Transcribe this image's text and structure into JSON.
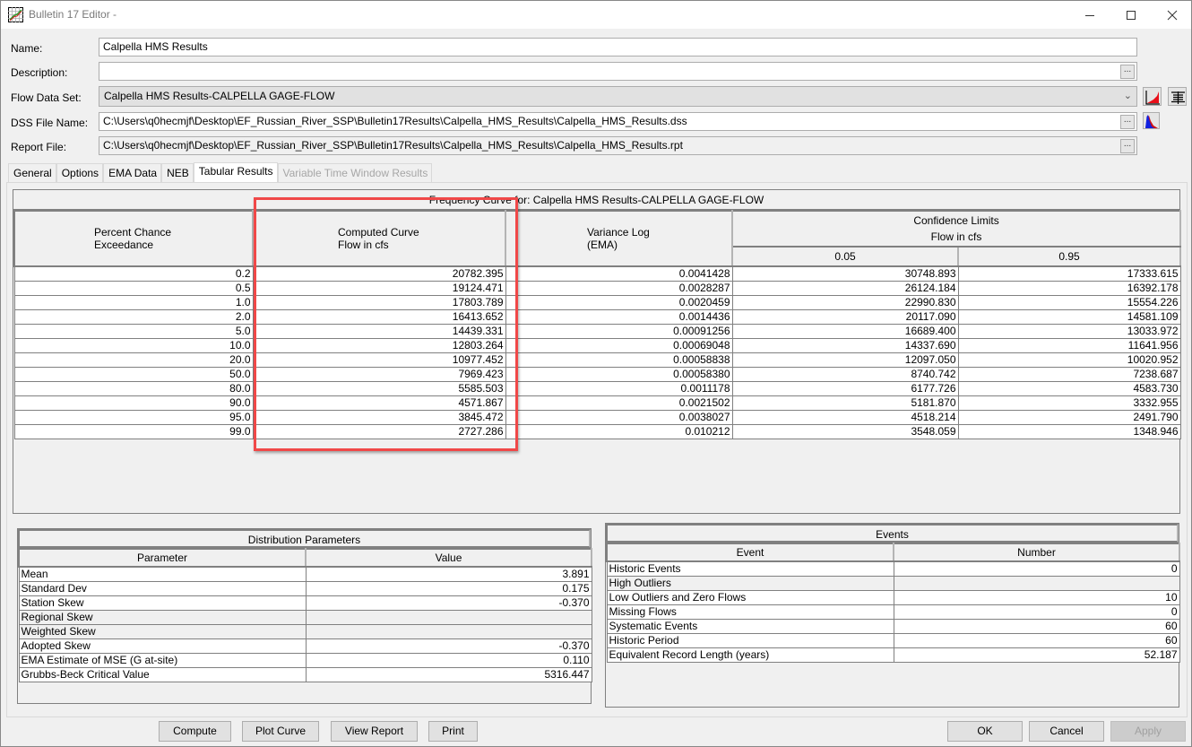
{
  "window": {
    "title": "Bulletin 17 Editor -",
    "minimize_icon": "minimize-icon",
    "maximize_icon": "maximize-icon",
    "close_icon": "close-icon"
  },
  "form": {
    "name_label": "Name:",
    "name_value": "Calpella HMS Results",
    "description_label": "Description:",
    "description_value": "",
    "flow_data_set_label": "Flow Data Set:",
    "flow_data_set_value": "Calpella HMS Results-CALPELLA GAGE-FLOW",
    "dss_file_label": "DSS File Name:",
    "dss_file_value": "C:\\Users\\q0hecmjf\\Desktop\\EF_Russian_River_SSP\\Bulletin17Results\\Calpella_HMS_Results\\Calpella_HMS_Results.dss",
    "report_file_label": "Report File:",
    "report_file_value": "C:\\Users\\q0hecmjf\\Desktop\\EF_Russian_River_SSP\\Bulletin17Results\\Calpella_HMS_Results\\Calpella_HMS_Results.rpt",
    "browse_label": "...",
    "dropdown_glyph": "⌄"
  },
  "tabs": [
    {
      "label": "General",
      "state": "normal"
    },
    {
      "label": "Options",
      "state": "normal"
    },
    {
      "label": "EMA Data",
      "state": "normal"
    },
    {
      "label": "NEB",
      "state": "normal"
    },
    {
      "label": "Tabular Results",
      "state": "active"
    },
    {
      "label": "Variable Time Window Results",
      "state": "disabled"
    }
  ],
  "frequency": {
    "title": "Frequency Curve for: Calpella HMS Results-CALPELLA GAGE-FLOW",
    "headers": {
      "pce_line1": "Percent Chance",
      "pce_line2": "Exceedance",
      "computed_line1": "Computed Curve",
      "computed_line2": "Flow in cfs",
      "variance_line1": "Variance Log",
      "variance_line2": "(EMA)",
      "confidence_line1": "Confidence Limits",
      "confidence_line2": "Flow in cfs",
      "conf_low": "0.05",
      "conf_high": "0.95"
    },
    "rows": [
      {
        "pce": "0.2",
        "computed": "20782.395",
        "variance": "0.0041428",
        "c05": "30748.893",
        "c95": "17333.615"
      },
      {
        "pce": "0.5",
        "computed": "19124.471",
        "variance": "0.0028287",
        "c05": "26124.184",
        "c95": "16392.178"
      },
      {
        "pce": "1.0",
        "computed": "17803.789",
        "variance": "0.0020459",
        "c05": "22990.830",
        "c95": "15554.226"
      },
      {
        "pce": "2.0",
        "computed": "16413.652",
        "variance": "0.0014436",
        "c05": "20117.090",
        "c95": "14581.109"
      },
      {
        "pce": "5.0",
        "computed": "14439.331",
        "variance": "0.00091256",
        "c05": "16689.400",
        "c95": "13033.972"
      },
      {
        "pce": "10.0",
        "computed": "12803.264",
        "variance": "0.00069048",
        "c05": "14337.690",
        "c95": "11641.956"
      },
      {
        "pce": "20.0",
        "computed": "10977.452",
        "variance": "0.00058838",
        "c05": "12097.050",
        "c95": "10020.952"
      },
      {
        "pce": "50.0",
        "computed": "7969.423",
        "variance": "0.00058380",
        "c05": "8740.742",
        "c95": "7238.687"
      },
      {
        "pce": "80.0",
        "computed": "5585.503",
        "variance": "0.0011178",
        "c05": "6177.726",
        "c95": "4583.730"
      },
      {
        "pce": "90.0",
        "computed": "4571.867",
        "variance": "0.0021502",
        "c05": "5181.870",
        "c95": "3332.955"
      },
      {
        "pce": "95.0",
        "computed": "3845.472",
        "variance": "0.0038027",
        "c05": "4518.214",
        "c95": "2491.790"
      },
      {
        "pce": "99.0",
        "computed": "2727.286",
        "variance": "0.010212",
        "c05": "3548.059",
        "c95": "1348.946"
      }
    ],
    "highlight_color": "#f04848"
  },
  "distribution": {
    "title": "Distribution Parameters",
    "col_parameter": "Parameter",
    "col_value": "Value",
    "rows": [
      {
        "param": "Mean",
        "value": "3.891"
      },
      {
        "param": "Standard Dev",
        "value": "0.175"
      },
      {
        "param": "Station Skew",
        "value": "-0.370"
      },
      {
        "param": "Regional Skew",
        "value": ""
      },
      {
        "param": "Weighted Skew",
        "value": ""
      },
      {
        "param": "Adopted Skew",
        "value": "-0.370"
      },
      {
        "param": "EMA Estimate of MSE (G at-site)",
        "value": "0.110"
      },
      {
        "param": "Grubbs-Beck Critical Value",
        "value": "5316.447"
      }
    ]
  },
  "events": {
    "title": "Events",
    "col_event": "Event",
    "col_number": "Number",
    "rows": [
      {
        "event": "Historic Events",
        "number": "0"
      },
      {
        "event": "High Outliers",
        "number": ""
      },
      {
        "event": "Low Outliers and Zero Flows",
        "number": "10"
      },
      {
        "event": "Missing Flows",
        "number": "0"
      },
      {
        "event": "Systematic Events",
        "number": "60"
      },
      {
        "event": "Historic Period",
        "number": "60"
      },
      {
        "event": "Equivalent Record Length (years)",
        "number": "52.187"
      }
    ]
  },
  "buttons": {
    "compute": "Compute",
    "plot_curve": "Plot Curve",
    "view_report": "View Report",
    "print": "Print",
    "ok": "OK",
    "cancel": "Cancel",
    "apply": "Apply"
  }
}
